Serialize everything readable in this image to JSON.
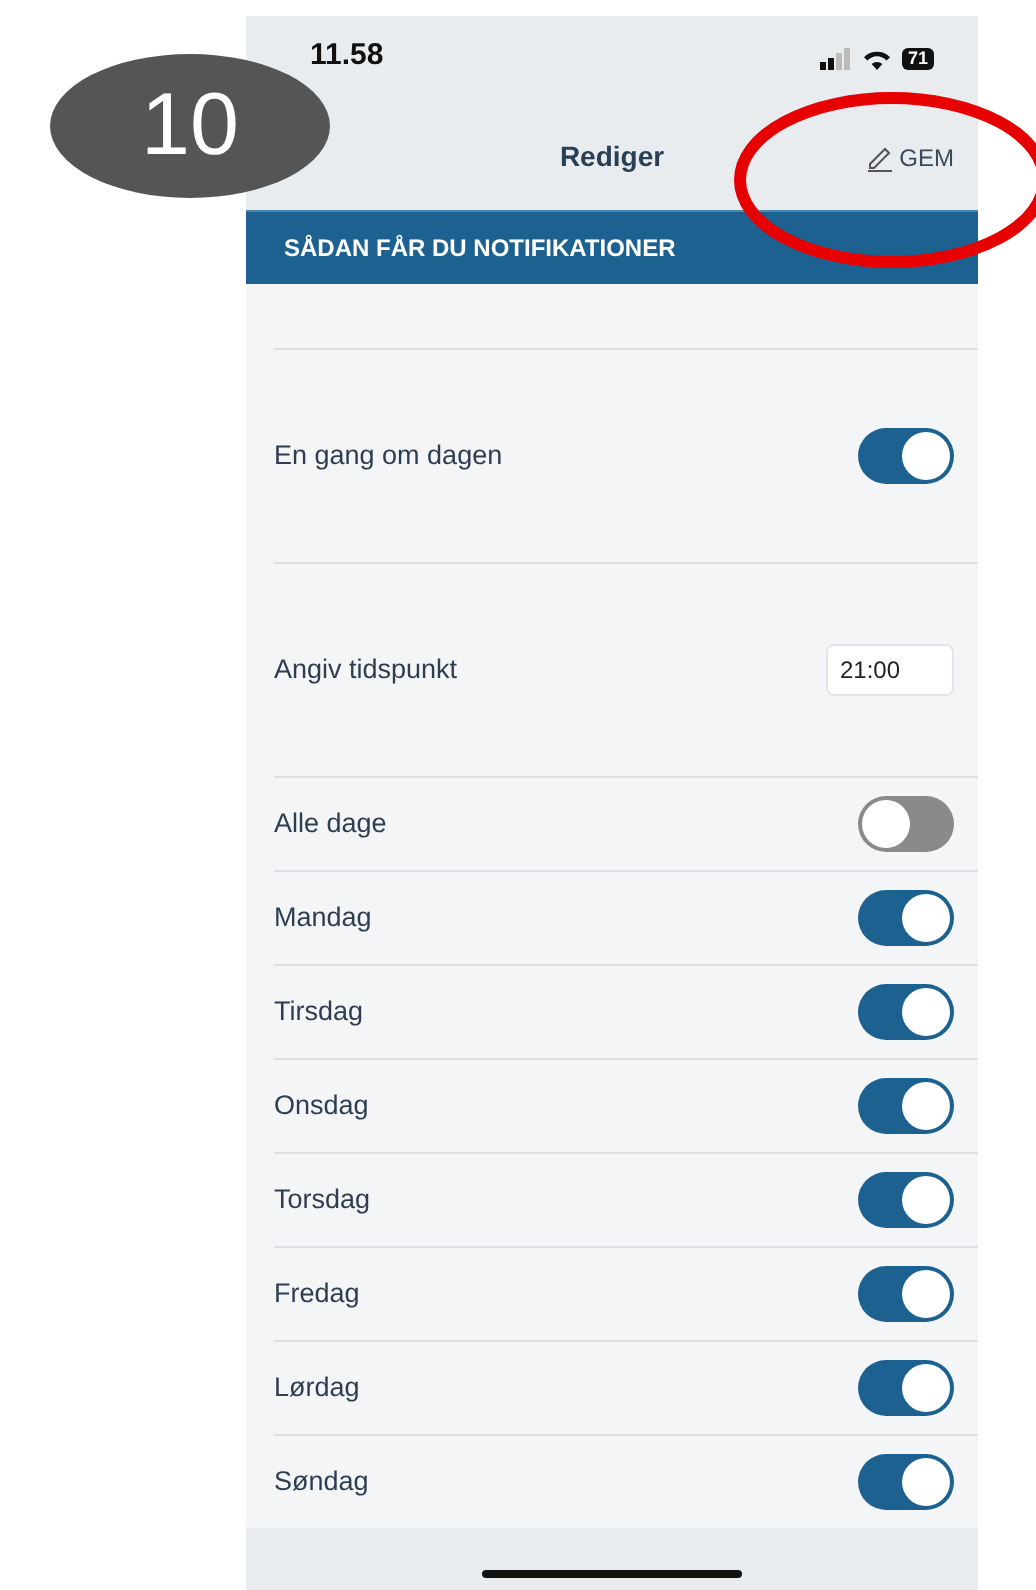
{
  "badge": "10",
  "status_bar": {
    "time": "11.58",
    "battery": "71"
  },
  "nav": {
    "title": "Rediger",
    "save": "GEM"
  },
  "section_header": "SÅDAN FÅR DU NOTIFIKATIONER",
  "daily": {
    "label": "En gang om dagen",
    "on": true
  },
  "time": {
    "label": "Angiv tidspunkt",
    "value": "21:00"
  },
  "days": [
    {
      "label": "Alle dage",
      "on": false
    },
    {
      "label": "Mandag",
      "on": true
    },
    {
      "label": "Tirsdag",
      "on": true
    },
    {
      "label": "Onsdag",
      "on": true
    },
    {
      "label": "Torsdag",
      "on": true
    },
    {
      "label": "Fredag",
      "on": true
    },
    {
      "label": "Lørdag",
      "on": true
    },
    {
      "label": "Søndag",
      "on": true
    }
  ]
}
